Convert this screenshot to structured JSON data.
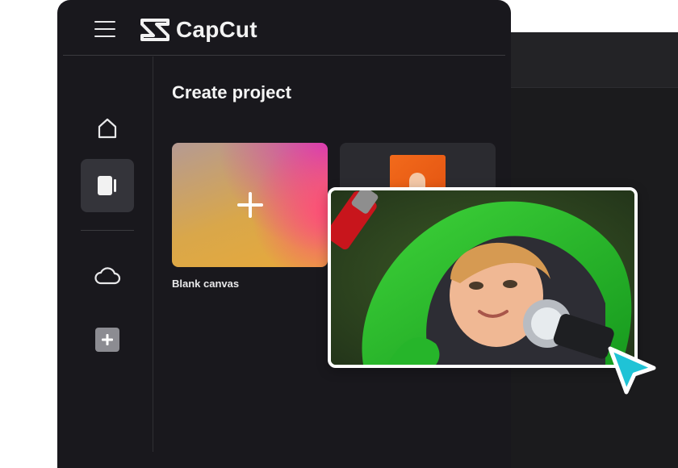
{
  "app": {
    "brand_name": "CapCut"
  },
  "sidebar": {
    "items": [
      {
        "icon": "home-icon",
        "active": false
      },
      {
        "icon": "video-editor-icon",
        "active": true
      },
      {
        "icon": "cloud-icon",
        "active": false
      },
      {
        "icon": "add-icon",
        "active": false
      }
    ]
  },
  "main": {
    "title": "Create project",
    "cards": [
      {
        "label": "Blank canvas"
      }
    ]
  },
  "colors": {
    "panel_bg": "#19181d",
    "active_item": "#34343a",
    "cursor": "#1fc3d6"
  }
}
